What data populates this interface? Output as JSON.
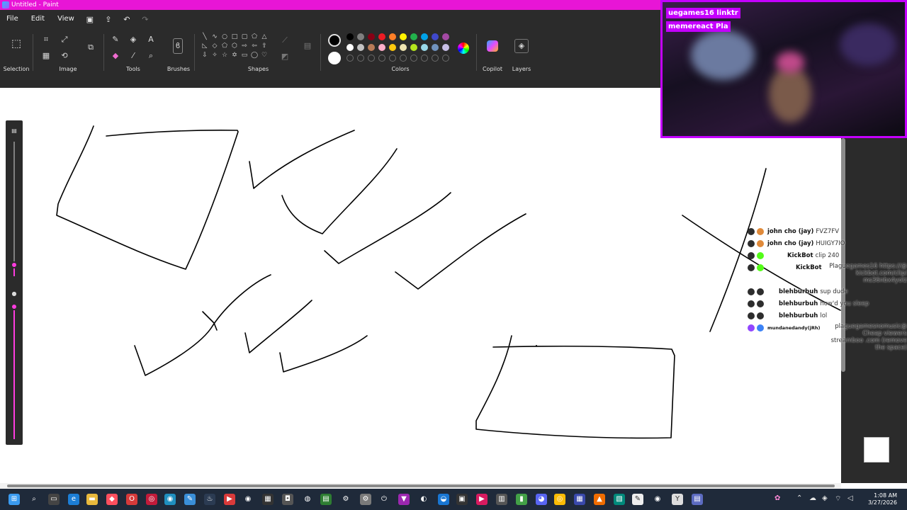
{
  "titlebar": {
    "title": "Untitled - Paint"
  },
  "menu": {
    "file": "File",
    "edit": "Edit",
    "view": "View"
  },
  "ribbon": {
    "selection": "Selection",
    "image": "Image",
    "tools": "Tools",
    "brushes": "Brushes",
    "shapes": "Shapes",
    "colors": "Colors",
    "copilot": "Copilot",
    "layers": "Layers"
  },
  "palette": {
    "row1": [
      "#000000",
      "#7f7f7f",
      "#880015",
      "#ed1c24",
      "#ff7f27",
      "#fff200",
      "#22b14c",
      "#00a2e8",
      "#3f48cc",
      "#a349a4"
    ],
    "row2": [
      "#ffffff",
      "#c3c3c3",
      "#b97a57",
      "#ffaec9",
      "#ffc90e",
      "#efe4b0",
      "#b5e61d",
      "#99d9ea",
      "#7092be",
      "#c8bfe7"
    ],
    "primary": "#000000",
    "secondary": "#ffffff"
  },
  "webcam": {
    "tag1": "uegames16 linktr",
    "tag2": "memereact Pla"
  },
  "chat": {
    "rows": [
      {
        "user": "john cho (jay)",
        "msg": "FVZ7FV"
      },
      {
        "user": "john cho (jay)",
        "msg": "HUIGY7IO"
      },
      {
        "user": "KickBot",
        "msg": "clip 240"
      },
      {
        "user": "KickBot",
        "msg": ""
      },
      {
        "user": "blehburbuh",
        "msg": "sup dude"
      },
      {
        "user": "blehburbuh",
        "msg": "how'd you sleep"
      },
      {
        "user": "blehburbuh",
        "msg": "lol"
      },
      {
        "user": "mundanedandy(jRh)",
        "msg": ""
      }
    ],
    "kickbot_msg": "Plaguegames16 https://@ kickbot.com/clip/ ms36nbx4yolz",
    "spam_msg": "plaguegamesnomusic@ Cheap viewers streamboo .com (remove the space)"
  },
  "taskbar": {
    "time": "1:08 AM",
    "date": "3/27/2026"
  }
}
